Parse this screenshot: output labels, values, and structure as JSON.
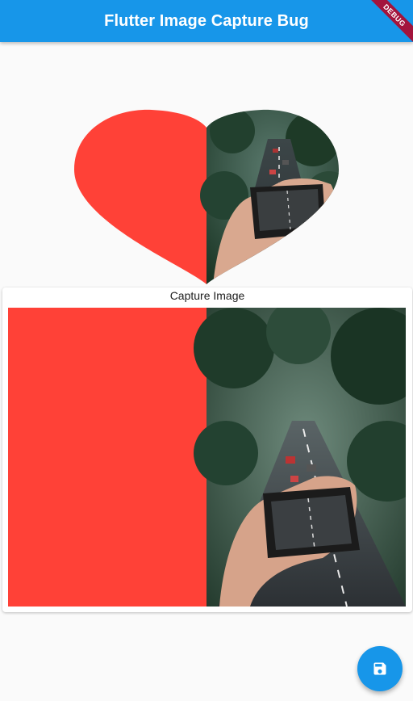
{
  "app": {
    "title": "Flutter Image Capture Bug",
    "debug_banner": "DEBUG"
  },
  "capture": {
    "label": "Capture Image"
  },
  "fab": {
    "icon": "save-icon"
  },
  "colors": {
    "appbar": "#1796e9",
    "heart_left": "#ff4137",
    "debug_banner": "#a3143c",
    "background": "#fafafa"
  }
}
